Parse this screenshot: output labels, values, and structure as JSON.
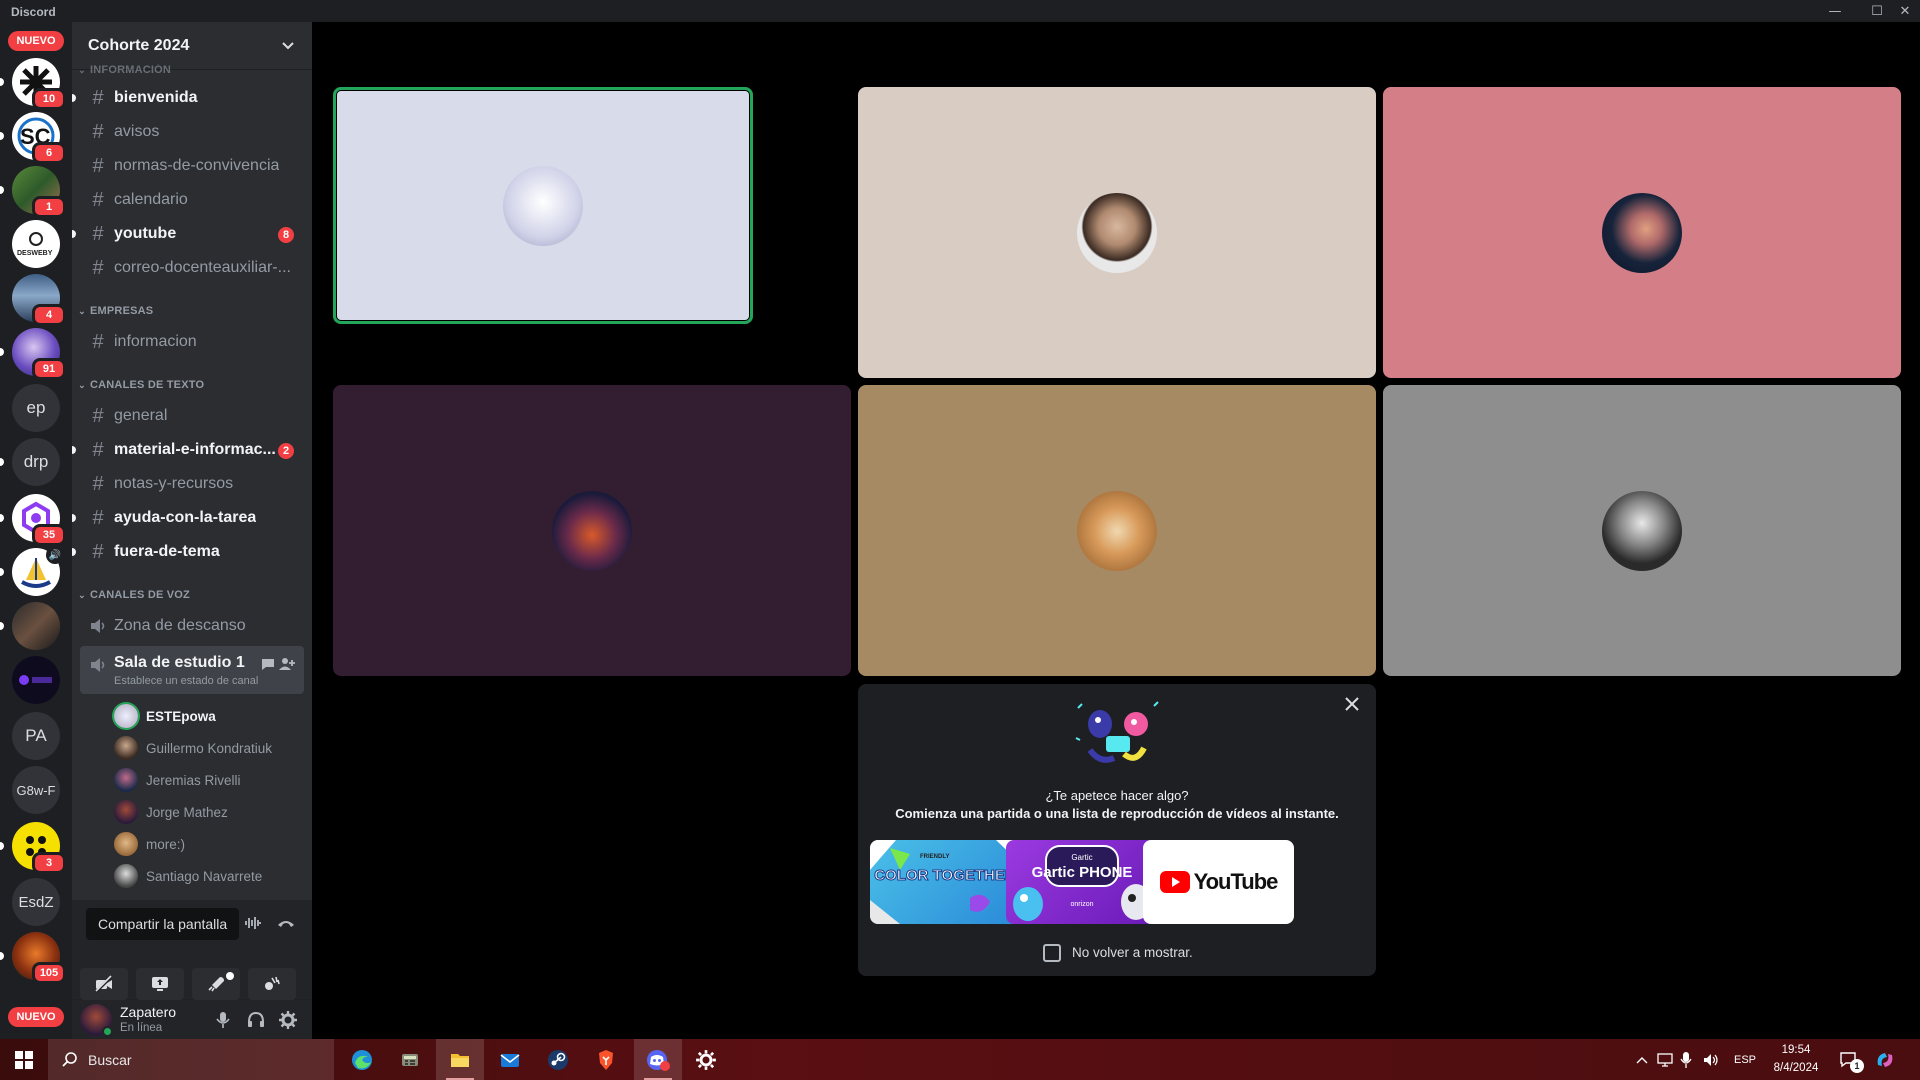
{
  "window": {
    "title": "Discord"
  },
  "servers": [
    {
      "label": "NUEVO",
      "kind": "new-pill"
    },
    {
      "label": "",
      "badge": "10"
    },
    {
      "label": "",
      "badge": "6"
    },
    {
      "label": "",
      "badge": "1"
    },
    {
      "label": "",
      "badge": ""
    },
    {
      "label": "",
      "badge": "4"
    },
    {
      "label": "",
      "badge": "91"
    },
    {
      "label": "ep",
      "badge": ""
    },
    {
      "label": "drp",
      "badge": ""
    },
    {
      "label": "",
      "badge": "35"
    },
    {
      "label": "",
      "badge": ""
    },
    {
      "label": "",
      "badge": ""
    },
    {
      "label": "",
      "badge": ""
    },
    {
      "label": "PA",
      "badge": ""
    },
    {
      "label": "G8w-F",
      "badge": ""
    },
    {
      "label": "",
      "badge": "3"
    },
    {
      "label": "EsdZ",
      "badge": ""
    },
    {
      "label": "",
      "badge": "105"
    },
    {
      "label": "NUEVO",
      "kind": "new-pill"
    }
  ],
  "guild": {
    "name": "Cohorte 2024"
  },
  "categories": {
    "info": "INFORMACIÓN",
    "empresas": "EMPRESAS",
    "texto": "CANALES DE TEXTO",
    "voz": "CANALES DE VOZ"
  },
  "channels": {
    "bienvenida": "bienvenida",
    "avisos": "avisos",
    "normas": "normas-de-convivencia",
    "calendario": "calendario",
    "youtube": "youtube",
    "youtube_mentions": "8",
    "correo": "correo-docenteauxiliar-...",
    "informacion": "informacion",
    "general": "general",
    "material": "material-e-informac...",
    "material_mentions": "2",
    "notas": "notas-y-recursos",
    "ayuda": "ayuda-con-la-tarea",
    "fuera": "fuera-de-tema",
    "zona": "Zona de descanso",
    "sala": "Sala de estudio 1",
    "sala_status": "Establece un estado de canal"
  },
  "voice_users": [
    "ESTEpowa",
    "Guillermo Kondratiuk",
    "Jeremias Rivelli",
    "Jorge Mathez",
    "more:)",
    "Santiago Navarrete"
  ],
  "voice_panel": {
    "tooltip": "Compartir la pantalla"
  },
  "user": {
    "name": "Zapatero",
    "status": "En línea"
  },
  "tiles": [
    {
      "bg": "#d8dbe9",
      "speaking": true
    },
    {
      "bg": "#d9ccc3",
      "speaking": false
    },
    {
      "bg": "#d47f88",
      "speaking": false
    },
    {
      "bg": "#321e30",
      "speaking": false
    },
    {
      "bg": "#a58a64",
      "speaking": false
    },
    {
      "bg": "#8e8e8e",
      "speaking": false
    }
  ],
  "activity": {
    "question": "¿Te apetece hacer algo?",
    "subtitle": "Comienza una partida o una lista de reproducción de vídeos al instante.",
    "cards": [
      "COLOR TOGETHER",
      "Gartic PHONE",
      "YouTube"
    ],
    "color_brand": "FRIENDLY",
    "phone_brand": "Gartic",
    "phone_maker": "onrizon",
    "dont_show": "No volver a mostrar."
  },
  "taskbar": {
    "search_placeholder": "Buscar",
    "lang": "ESP",
    "time": "19:54",
    "date": "8/4/2024",
    "notif_count": "1"
  },
  "colors": {
    "accent_green": "#23a55a",
    "mention_red": "#f23f43"
  }
}
